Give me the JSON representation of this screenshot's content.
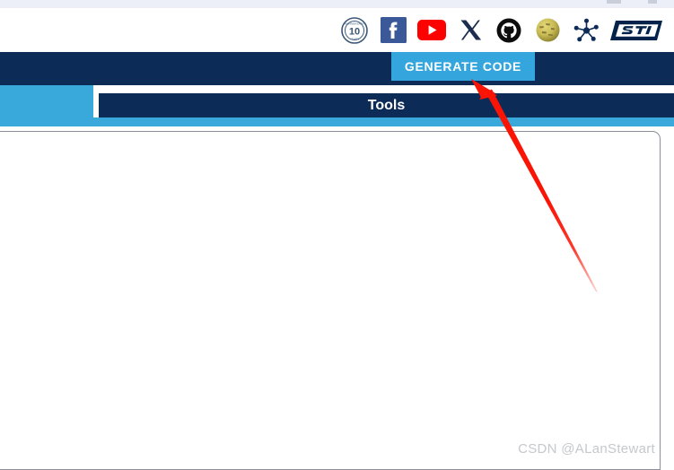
{
  "window": {
    "top_strip_color": "#eceff8"
  },
  "social_bar": {
    "icons": [
      {
        "name": "anniversary-10-years-badge-icon",
        "label": "10 Years Badge"
      },
      {
        "name": "facebook-icon",
        "label": "Facebook"
      },
      {
        "name": "youtube-icon",
        "label": "YouTube"
      },
      {
        "name": "x-twitter-icon",
        "label": "X"
      },
      {
        "name": "github-icon",
        "label": "GitHub"
      },
      {
        "name": "wikipedia-icon",
        "label": "Wikipedia"
      },
      {
        "name": "st-community-network-icon",
        "label": "ST Community"
      },
      {
        "name": "st-logo-icon",
        "label": "ST"
      }
    ]
  },
  "nav_bar": {
    "generate_code_label": "GENERATE CODE",
    "background_color": "#0c2b56",
    "button_color": "#34a5dd"
  },
  "tabs": {
    "accent_color": "#39a9dc",
    "active_tab_label": "Tools",
    "underline_color": "#39a9dc"
  },
  "content": {
    "body_text": ""
  },
  "watermark": {
    "text": "CSDN @ALanStewart"
  },
  "annotation": {
    "arrow_color": "#fa1405",
    "points_to": "GENERATE CODE"
  }
}
